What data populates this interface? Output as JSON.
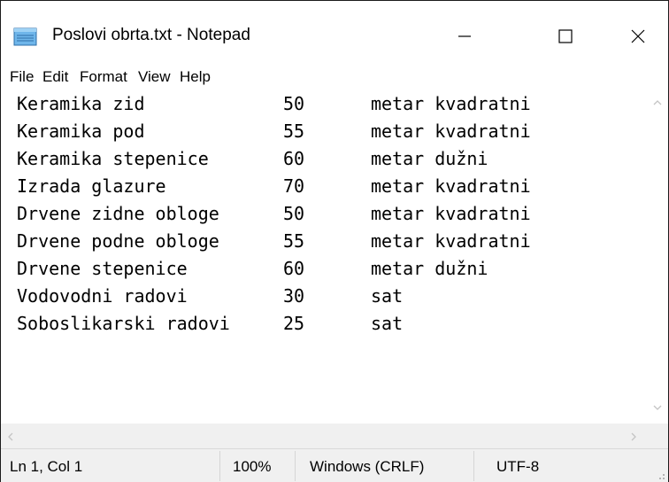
{
  "window": {
    "title": "Poslovi obrta.txt - Notepad"
  },
  "menu": {
    "items": [
      "File",
      "Edit",
      "Format",
      "View",
      "Help"
    ]
  },
  "editor": {
    "lines": [
      {
        "name": "Keramika zid",
        "qty": "50",
        "unit": "metar kvadratni"
      },
      {
        "name": "Keramika pod",
        "qty": "55",
        "unit": "metar kvadratni"
      },
      {
        "name": "Keramika stepenice",
        "qty": "60",
        "unit": "metar dužni"
      },
      {
        "name": "Izrada glazure",
        "qty": "70",
        "unit": "metar kvadratni"
      },
      {
        "name": "Drvene zidne obloge",
        "qty": "50",
        "unit": "metar kvadratni"
      },
      {
        "name": "Drvene podne obloge",
        "qty": "55",
        "unit": "metar kvadratni"
      },
      {
        "name": "Drvene stepenice",
        "qty": "60",
        "unit": "metar dužni"
      },
      {
        "name": "Vodovodni radovi",
        "qty": "30",
        "unit": "sat"
      },
      {
        "name": "Soboslikarski radovi",
        "qty": "25",
        "unit": "sat"
      }
    ]
  },
  "status": {
    "position": "Ln 1, Col 1",
    "zoom": "100%",
    "line_ending": "Windows (CRLF)",
    "encoding": "UTF-8"
  },
  "icons": {
    "app": "notepad-icon",
    "minimize": "minimize-icon",
    "maximize": "maximize-icon",
    "close": "close-icon",
    "scroll_up": "chevron-up-icon",
    "scroll_down": "chevron-down-icon",
    "scroll_left": "chevron-left-icon",
    "scroll_right": "chevron-right-icon",
    "resize": "resize-grip-icon"
  }
}
